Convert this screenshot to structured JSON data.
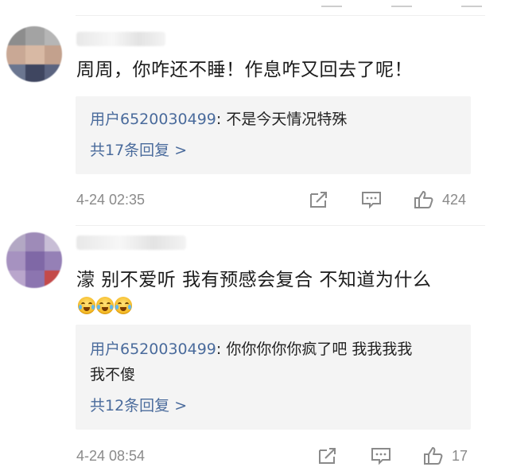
{
  "comments": [
    {
      "text": "周周，你咋还不睡！作息咋又回去了呢！",
      "reply": {
        "user": "用户6520030499",
        "lines": [
          "不是今天情况特殊"
        ],
        "count_label": "共17条回复 >"
      },
      "timestamp": "4-24 02:35",
      "likes": "424",
      "icons": [
        "share-icon",
        "comment-icon",
        "like-icon"
      ]
    },
    {
      "text": "濛 别不爱听 我有预感会复合 不知道为什么",
      "emojis": [
        "crying-laughing-emoji",
        "crying-laughing-emoji",
        "crying-laughing-emoji"
      ],
      "reply": {
        "user": "用户6520030499",
        "lines": [
          "你你你你你疯了吧 我我我我",
          "我不傻"
        ],
        "count_label": "共12条回复 >"
      },
      "timestamp": "4-24 08:54",
      "likes": "17",
      "icons": [
        "share-icon",
        "comment-icon",
        "like-icon"
      ]
    }
  ],
  "colors": {
    "link_blue": "#4a6b9c",
    "meta_gray": "#8a8a8a",
    "reply_bg": "#f4f4f4"
  }
}
